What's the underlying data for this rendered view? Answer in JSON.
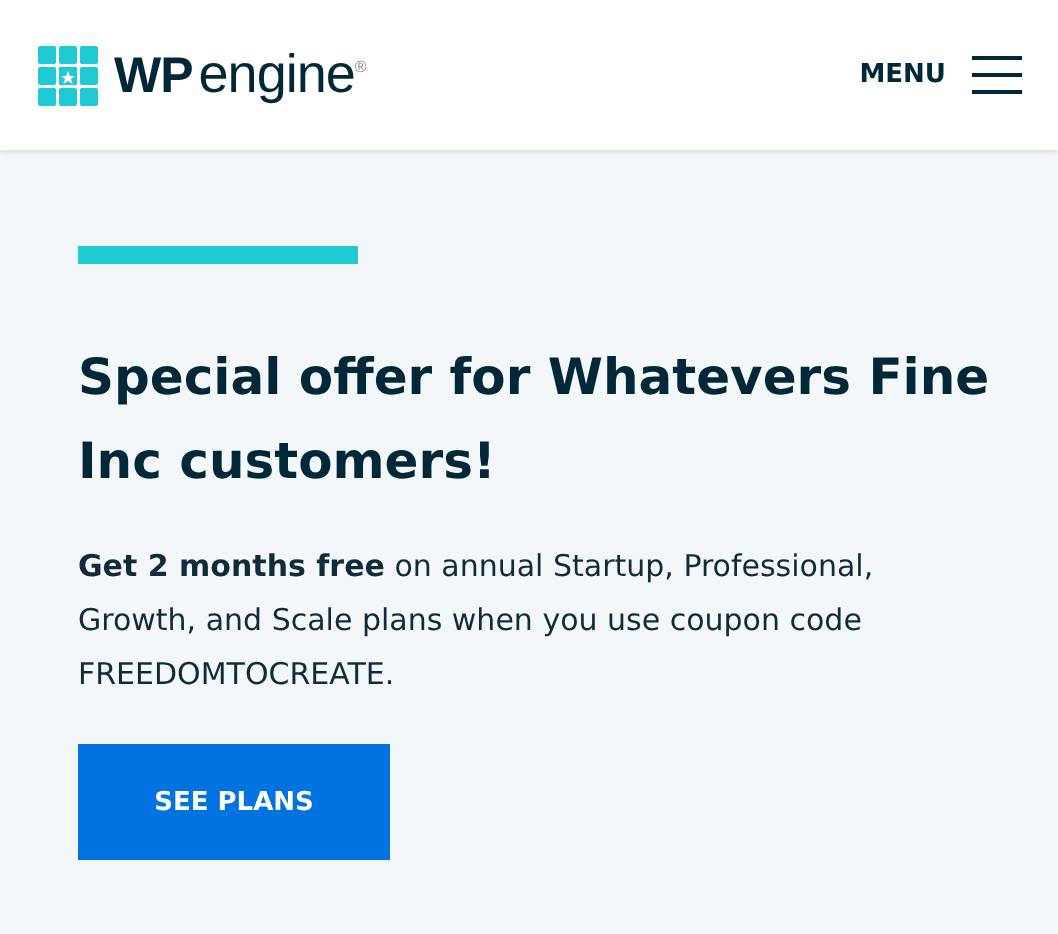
{
  "header": {
    "logo": "**WP**engine$^{®}$",
    "menu_label": "MENU"
  },
  "offer": {
    "heading": "Special offer for Whatevers Fine Inc customers!",
    "body": "**Get 2 months free** on annual Startup, Professional, Growth, and Scale plans when you use coupon code FREEDOMTOCREATE.",
    "button": "SEE PLANS"
  }
}
